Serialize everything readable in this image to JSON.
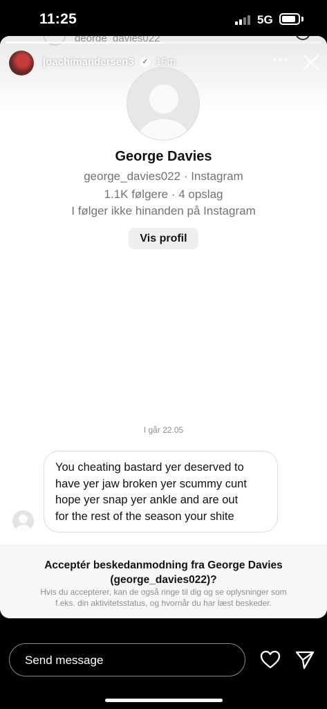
{
  "status_bar": {
    "time": "11:25",
    "network": "5G",
    "signal_bars": 4,
    "signal_active": 2
  },
  "underlay": {
    "handle": "george_davies022"
  },
  "story": {
    "progress": 0.5,
    "username": "joachimandersen3",
    "verified_icon": "verified-badge-icon",
    "time_ago": "15m",
    "more_icon": "ellipsis-icon",
    "close_icon": "close-icon"
  },
  "profile": {
    "name": "George Davies",
    "handle_line": "george_davies022 · Instagram",
    "stats_line": "1.1K følgere · 4 opslag",
    "relationship_line": "I følger ikke hinanden på Instagram",
    "button_label": "Vis profil"
  },
  "conversation": {
    "date_label": "I går 22.05",
    "message": "You cheating bastard yer deserved to\nhave yer jaw broken yer scummy cunt\nhope yer snap yer ankle and are out\nfor the rest of the season your shite"
  },
  "request": {
    "title_line1": "Acceptér beskedanmodning fra George Davies",
    "title_line2": "(george_davies022)?",
    "description_line1": "Hvis du accepterer, kan de også ringe til dig og se oplysninger som",
    "description_line2": "f.eks. din aktivitetsstatus, og hvornår du har læst beskeder."
  },
  "composer": {
    "placeholder": "Send message",
    "heart_icon": "heart-icon",
    "send_icon": "paper-plane-icon"
  },
  "colors": {
    "background": "#000000",
    "card": "#ffffff",
    "muted_text": "#737373",
    "button_bg": "#efefef"
  }
}
